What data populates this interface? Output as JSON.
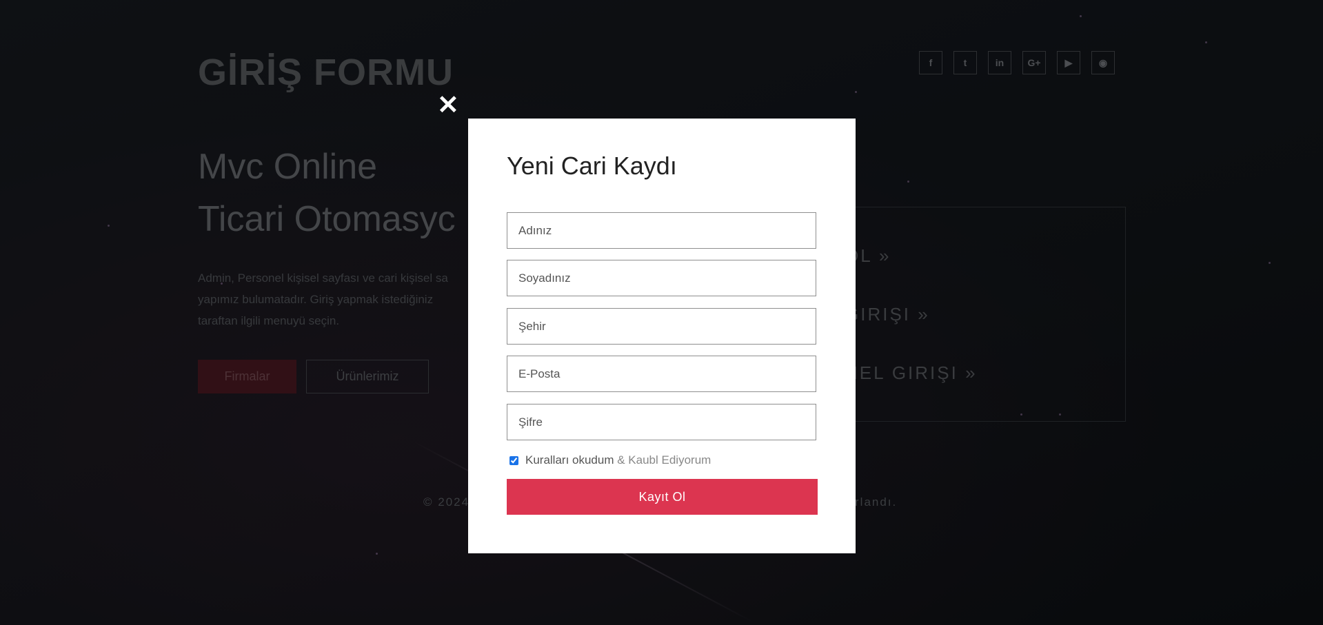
{
  "header": {
    "title": "GİRİŞ FORMU",
    "socials": [
      {
        "icon": "facebook-icon",
        "glyph": "f"
      },
      {
        "icon": "twitter-icon",
        "glyph": "t"
      },
      {
        "icon": "linkedin-icon",
        "glyph": "in"
      },
      {
        "icon": "google-plus-icon",
        "glyph": "G+"
      },
      {
        "icon": "youtube-icon",
        "glyph": "▶"
      },
      {
        "icon": "github-icon",
        "glyph": "◉"
      }
    ]
  },
  "hero": {
    "line1": "Mvc Online",
    "line2": "Ticari Otomasyc",
    "description": "Admin, Personel kişisel sayfası ve cari kişisel sa yapımız bulumatadır. Giriş yapmak istediğiniz taraftan ilgili menuyü seçin.",
    "btn_firmalar": "Firmalar",
    "btn_urunler": "Ürünlerimiz"
  },
  "panel": {
    "link1": "OL »",
    "link2": "GIRIŞI »",
    "link3": "NEL GIRIŞI »"
  },
  "footer": {
    "left": "© 2024",
    "right": "rlandı."
  },
  "modal": {
    "close_symbol": "✕",
    "title": "Yeni Cari Kaydı",
    "fields": [
      {
        "placeholder": "Adınız"
      },
      {
        "placeholder": "Soyadınız"
      },
      {
        "placeholder": "Şehir"
      },
      {
        "placeholder": "E-Posta"
      },
      {
        "placeholder": "Şifre"
      }
    ],
    "terms_checked": true,
    "terms_strong": "Kuralları okudum",
    "terms_light": "& Kaubl Ediyorum",
    "submit_label": "Kayıt Ol"
  },
  "colors": {
    "accent": "#dc3550",
    "background": "#1a1e23",
    "modal": "#ffffff"
  }
}
